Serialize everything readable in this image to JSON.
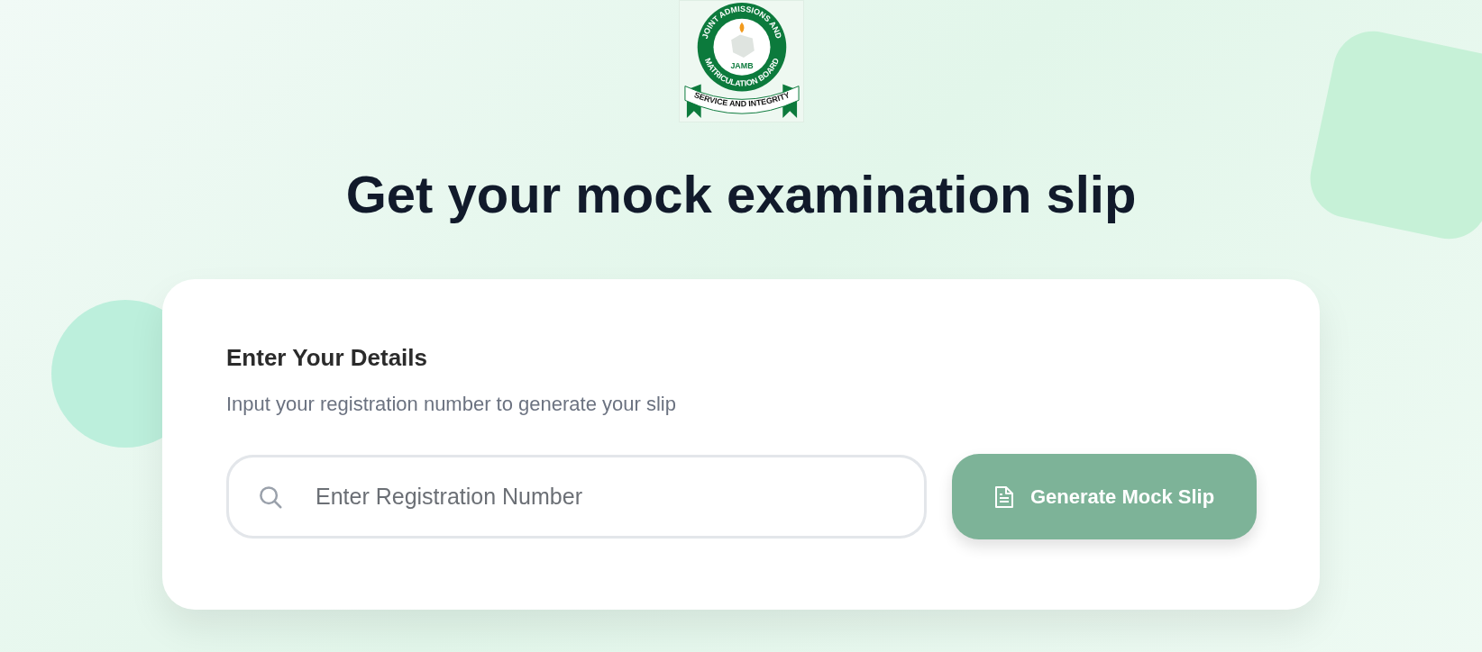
{
  "logo": {
    "top_text": "JOINT ADMISSIONS AND",
    "bottom_text": "MATRICULATION BOARD",
    "center_text": "JAMB",
    "ribbon_text": "SERVICE AND INTEGRITY"
  },
  "heading": "Get your mock examination slip",
  "card": {
    "title": "Enter Your Details",
    "subtitle": "Input your registration number to generate your slip",
    "field": {
      "placeholder": "Enter Registration Number"
    },
    "button": {
      "label": "Generate Mock Slip",
      "disabled": true
    }
  }
}
